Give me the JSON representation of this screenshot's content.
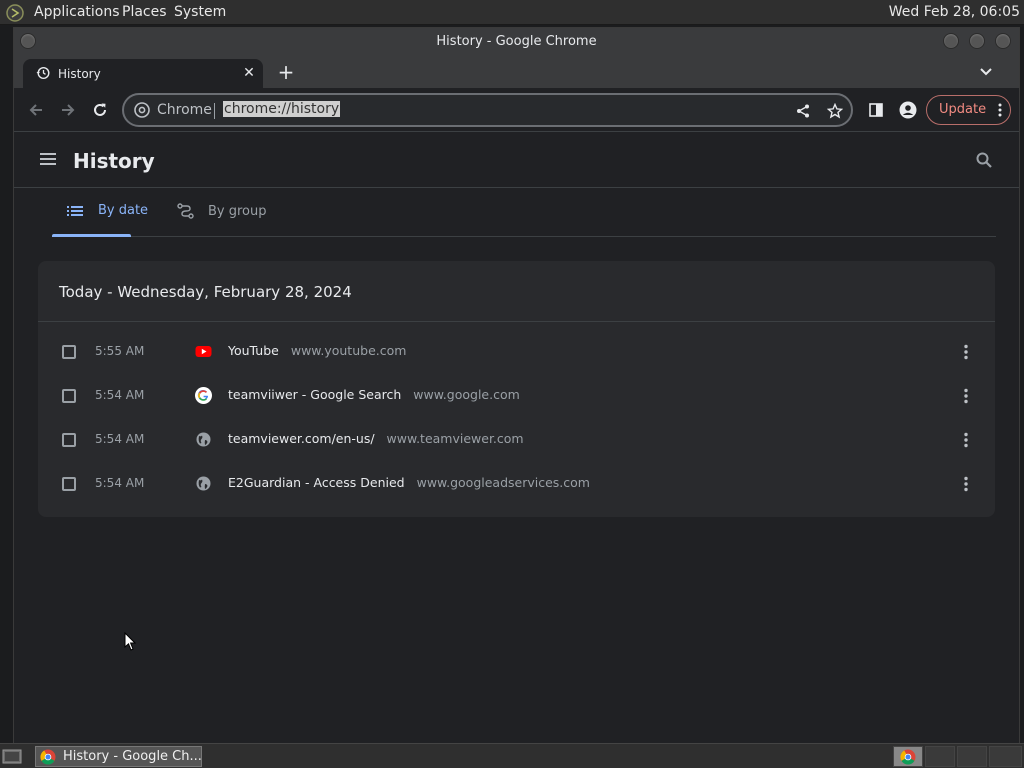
{
  "system": {
    "menus": [
      "Applications",
      "Places",
      "System"
    ],
    "clock": "Wed Feb 28, 06:05"
  },
  "window": {
    "title": "History - Google Chrome"
  },
  "tabs": {
    "active_label": "History",
    "close_symbol": "✕",
    "new_tab_symbol": "+"
  },
  "toolbar": {
    "site_chip": "Chrome",
    "url": "chrome://history",
    "update_label": "Update"
  },
  "page": {
    "title": "History",
    "tab_by_date": "By date",
    "tab_by_group": "By group",
    "day_header": "Today - Wednesday, February 28, 2024",
    "entries": [
      {
        "time": "5:55 AM",
        "title": "YouTube",
        "domain": "www.youtube.com",
        "icon": "youtube-icon"
      },
      {
        "time": "5:54 AM",
        "title": "teamviiwer - Google Search",
        "domain": "www.google.com",
        "icon": "google-icon"
      },
      {
        "time": "5:54 AM",
        "title": "teamviewer.com/en-us/",
        "domain": "www.teamviewer.com",
        "icon": "globe-icon"
      },
      {
        "time": "5:54 AM",
        "title": "E2Guardian - Access Denied",
        "domain": "www.googleadservices.com",
        "icon": "globe-icon"
      }
    ]
  },
  "taskbar": {
    "task_label": "History - Google Ch..."
  },
  "colors": {
    "accent": "#8ab4f8",
    "update": "#f28b82",
    "background": "#202124",
    "card": "#292a2d"
  }
}
